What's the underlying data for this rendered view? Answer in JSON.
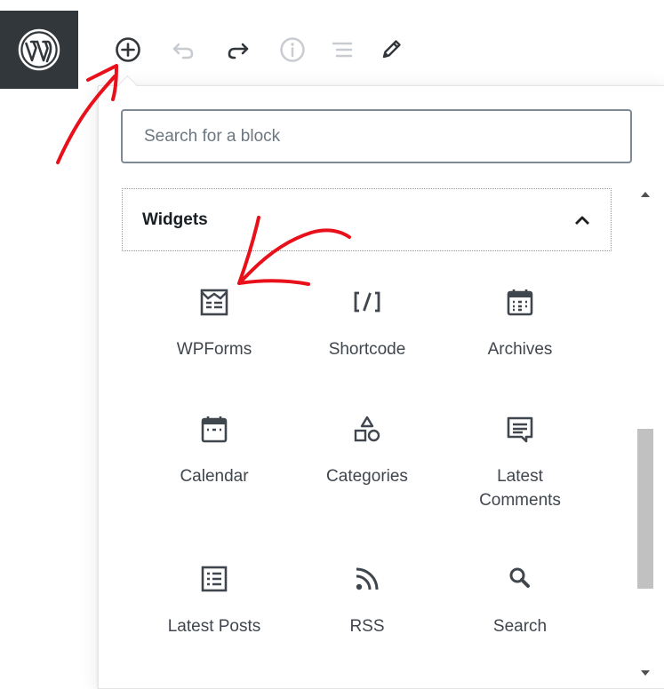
{
  "toolbar": {
    "logo_icon": "wordpress-logo-icon",
    "buttons": [
      {
        "name": "add-block-button",
        "icon": "plus-circle-icon"
      },
      {
        "name": "undo-button",
        "icon": "undo-icon"
      },
      {
        "name": "redo-button",
        "icon": "redo-icon"
      },
      {
        "name": "info-button",
        "icon": "info-icon"
      },
      {
        "name": "block-navigation-button",
        "icon": "list-icon"
      },
      {
        "name": "tools-button",
        "icon": "pencil-icon"
      }
    ]
  },
  "inserter": {
    "search": {
      "placeholder": "Search for a block",
      "value": ""
    },
    "panel": {
      "title": "Widgets",
      "expanded": true
    },
    "blocks": [
      {
        "label": "WPForms",
        "icon": "wpforms-icon"
      },
      {
        "label": "Shortcode",
        "icon": "shortcode-icon"
      },
      {
        "label": "Archives",
        "icon": "archives-calendar-icon"
      },
      {
        "label": "Calendar",
        "icon": "calendar-icon"
      },
      {
        "label": "Categories",
        "icon": "categories-icon"
      },
      {
        "label": "Latest\nComments",
        "icon": "comment-icon"
      },
      {
        "label": "Latest Posts",
        "icon": "list-view-icon"
      },
      {
        "label": "RSS",
        "icon": "rss-icon"
      },
      {
        "label": "Search",
        "icon": "search-icon"
      }
    ]
  },
  "colors": {
    "logo_background": "#32373c",
    "icon_dark": "#40464d",
    "icon_disabled": "#c8ccd0",
    "annotation_red": "#e8101a"
  }
}
